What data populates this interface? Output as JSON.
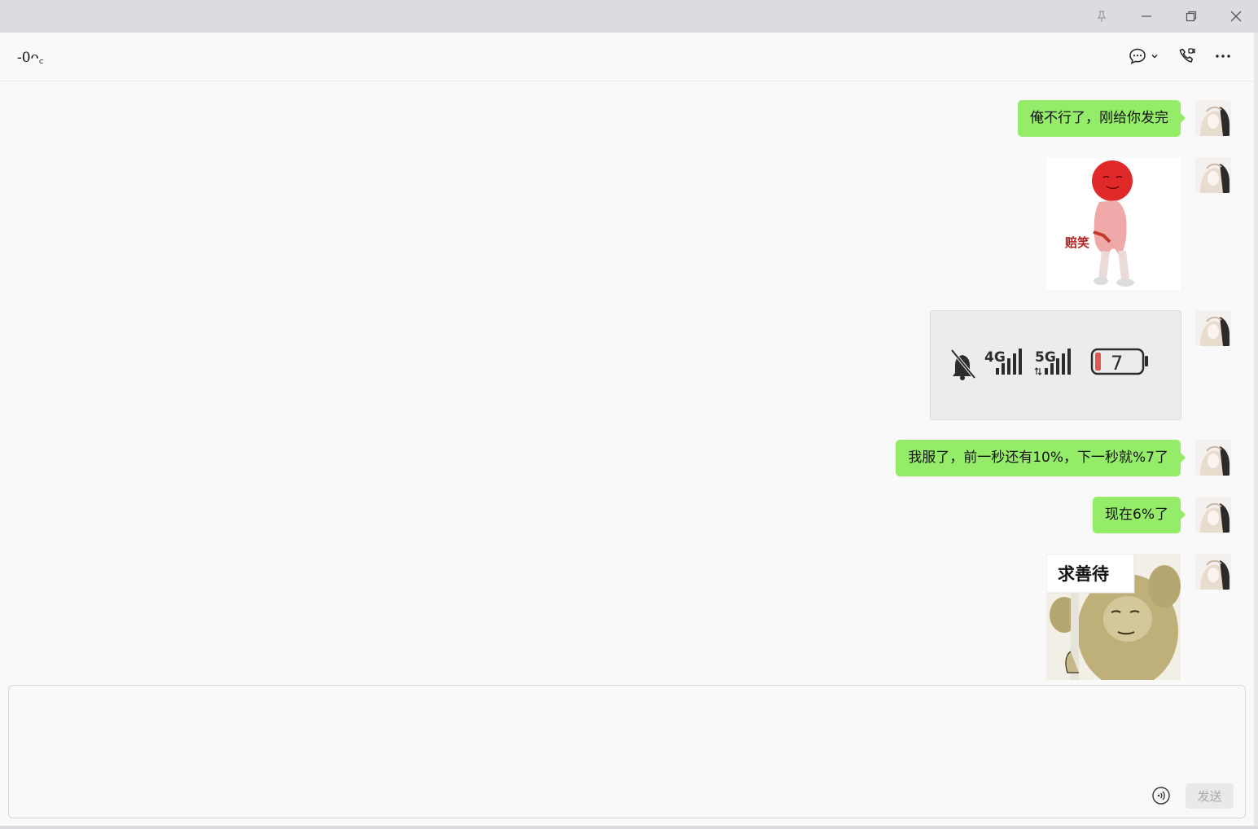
{
  "window": {
    "controls": [
      "pin-icon",
      "minimize-icon",
      "restore-icon",
      "close-icon"
    ]
  },
  "header": {
    "title": "-0ᴖ꜀",
    "icons": [
      "chat-bubble-icon",
      "chevron-down-icon",
      "phone-video-icon",
      "more-icon"
    ]
  },
  "messages": [
    {
      "type": "text",
      "text": "俺不行了，刚给你发完"
    },
    {
      "type": "sticker",
      "caption": "赔笑"
    },
    {
      "type": "image",
      "battery_level": "7"
    },
    {
      "type": "text",
      "text": "我服了，前一秒还有10%，下一秒就%7了"
    },
    {
      "type": "text",
      "text": "现在6%了"
    },
    {
      "type": "sticker",
      "caption": "求善待"
    }
  ],
  "status_image": {
    "label_4g": "4G",
    "label_5g": "5G",
    "battery_text": "7"
  },
  "composer": {
    "placeholder": "",
    "send_label": "发送"
  },
  "colors": {
    "bubble_self": "#95ec69",
    "background": "#f9f9f9",
    "titlebar": "#dcdce0"
  }
}
